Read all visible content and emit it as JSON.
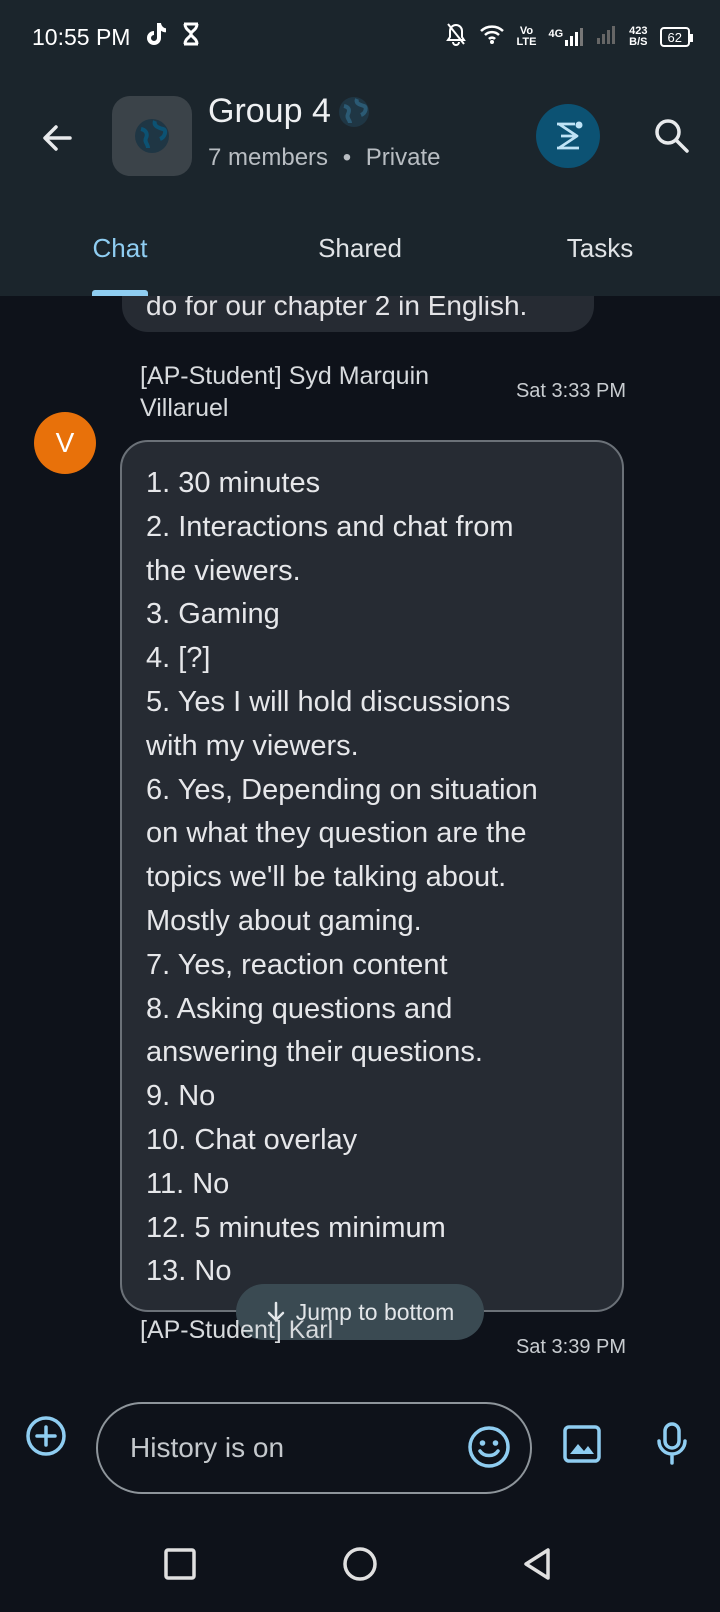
{
  "status_bar": {
    "time": "10:55 PM",
    "net_top": "Vo",
    "net_bottom": "LTE",
    "speed_top": "423",
    "speed_bottom": "B/S",
    "signal_label": "4G",
    "battery": "62"
  },
  "header": {
    "title": "Group 4",
    "subtitle": "7 members",
    "privacy": "Private",
    "icons": [
      "back-arrow-icon",
      "globe-icon",
      "gem-icon",
      "search-icon"
    ]
  },
  "tabs": [
    {
      "label": "Chat",
      "active": true
    },
    {
      "label": "Shared",
      "active": false
    },
    {
      "label": "Tasks",
      "active": false
    }
  ],
  "chat": {
    "previous_message_tail": "do for our chapter 2 in English.",
    "messages": [
      {
        "sender_line1": "[AP-Student] Syd Marquin",
        "sender_line2": "Villaruel",
        "time": "Sat 3:33 PM",
        "avatar_initial": "V",
        "lines": [
          "1. 30 minutes",
          "2. Interactions and chat from",
          "the viewers.",
          "3. Gaming",
          "4. [?]",
          "5. Yes I will hold discussions",
          "with my viewers.",
          "6. Yes, Depending on situation",
          "on what they question are the",
          "topics we'll be talking about.",
          "Mostly about gaming.",
          "7. Yes, reaction content",
          "8. Asking questions and",
          "answering their questions.",
          "9. No",
          "10. Chat overlay",
          "11. No",
          "12. 5 minutes minimum",
          "13. No"
        ]
      },
      {
        "sender_line1": "[AP-Student] Karl",
        "time": "Sat 3:39 PM"
      }
    ],
    "jump_label": "Jump to bottom"
  },
  "composer": {
    "placeholder": "History is on"
  },
  "colors": {
    "accent": "#8fcdf1",
    "avatar": "#e8710a",
    "header_bg": "#1b252c",
    "body_bg": "#0e121a"
  }
}
